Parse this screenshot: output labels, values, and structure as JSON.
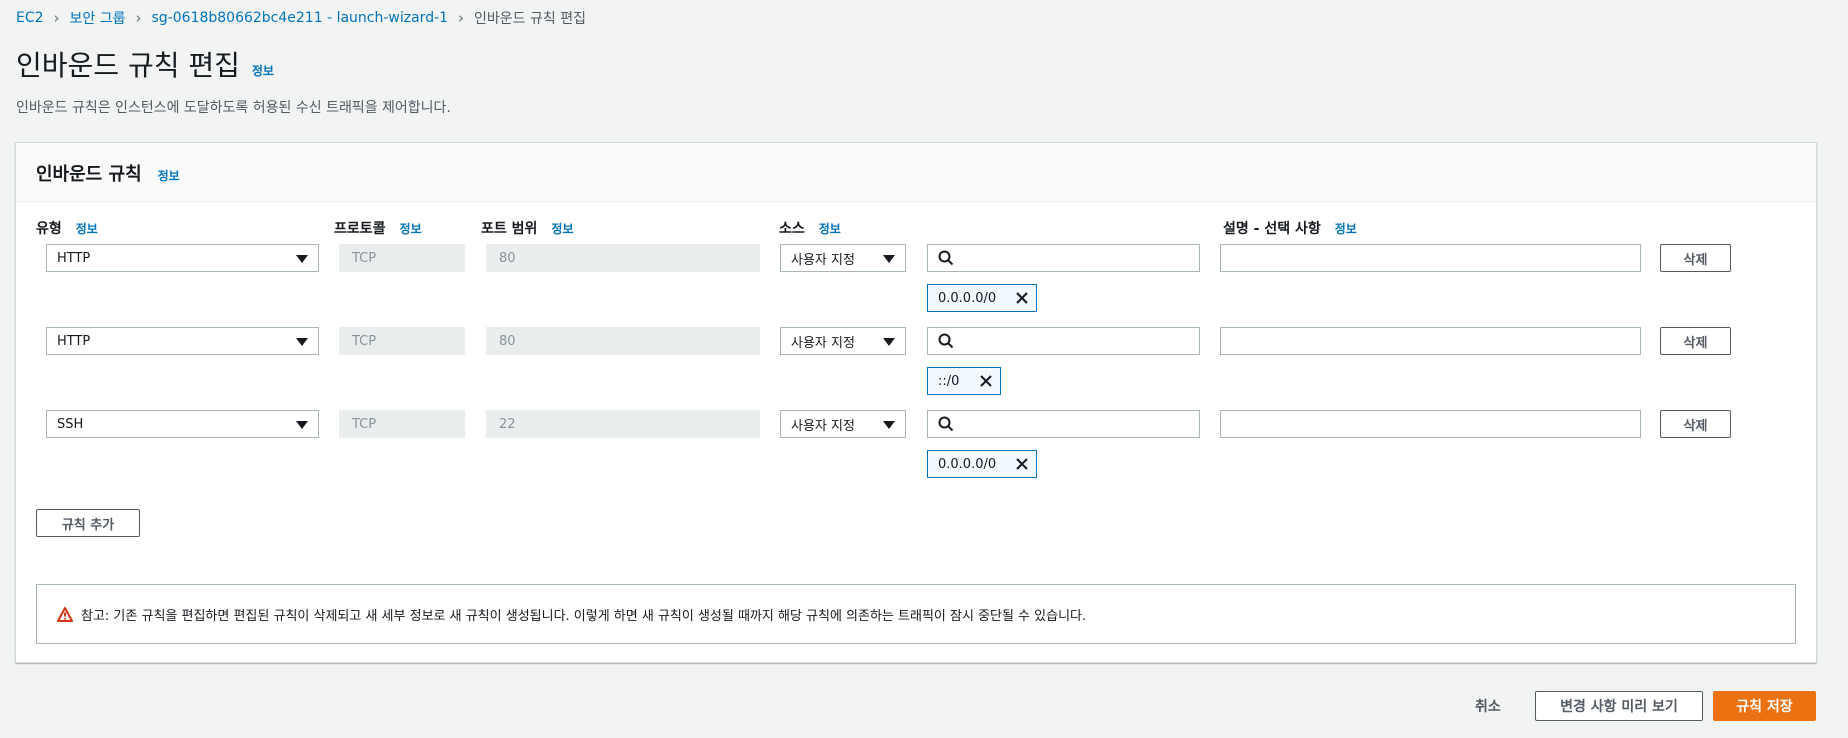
{
  "breadcrumb": {
    "items": [
      "EC2",
      "보안 그룹",
      "sg-0618b80662bc4e211 - launch-wizard-1"
    ],
    "current": "인바운드 규칙 편집"
  },
  "page": {
    "title": "인바운드 규칙 편집",
    "info": "정보",
    "description": "인바운드 규칙은 인스턴스에 도달하도록 허용된 수신 트래픽을 제어합니다."
  },
  "panel": {
    "title": "인바운드 규칙",
    "info": "정보",
    "columns": {
      "type": "유형",
      "protocol": "프로토콜",
      "port_range": "포트 범위",
      "source": "소스",
      "description": "설명 - 선택 사항",
      "info": "정보"
    },
    "rules": [
      {
        "type": "HTTP",
        "protocol": "TCP",
        "port": "80",
        "source_mode": "사용자 지정",
        "search_value": "",
        "token": "0.0.0.0/0",
        "description": "",
        "delete": "삭제"
      },
      {
        "type": "HTTP",
        "protocol": "TCP",
        "port": "80",
        "source_mode": "사용자 지정",
        "search_value": "",
        "token": "::/0",
        "description": "",
        "delete": "삭제"
      },
      {
        "type": "SSH",
        "protocol": "TCP",
        "port": "22",
        "source_mode": "사용자 지정",
        "search_value": "",
        "token": "0.0.0.0/0",
        "description": "",
        "delete": "삭제"
      }
    ],
    "add_rule": "규칙 추가",
    "alert": "참고: 기존 규칙을 편집하면 편집된 규칙이 삭제되고 새 세부 정보로 새 규칙이 생성됩니다. 이렇게 하면 새 규칙이 생성될 때까지 해당 규칙에 의존하는 트래픽이 잠시 중단될 수 있습니다."
  },
  "footer": {
    "cancel": "취소",
    "preview": "변경 사항 미리 보기",
    "save": "규칙 저장"
  },
  "colors": {
    "accent": "#ec7211",
    "link": "#0073bb",
    "warning": "#d13212"
  }
}
